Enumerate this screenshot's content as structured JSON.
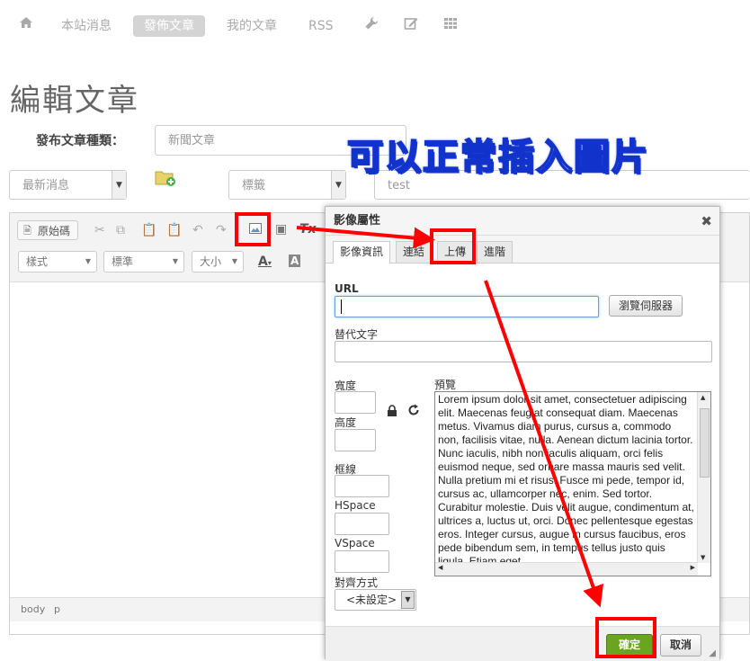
{
  "nav": {
    "items": [
      {
        "label": "本站消息",
        "active": false
      },
      {
        "label": "發佈文章",
        "active": true
      },
      {
        "label": "我的文章",
        "active": false
      },
      {
        "label": "RSS",
        "active": false
      }
    ]
  },
  "page": {
    "title": "編輯文章",
    "category_label": "發布文章種類：",
    "category_value": "新聞文章",
    "subcategory_value": "最新消息",
    "tag_select_value": "標籤",
    "tag_input_value": "test"
  },
  "annotation": {
    "banner": "可以正常插入圖片",
    "color": "#ff0000"
  },
  "editor": {
    "source_label": "原始碼",
    "style_combo": "樣式",
    "format_combo": "標準",
    "size_combo": "大小",
    "status_path": [
      "body",
      "p"
    ]
  },
  "dialog": {
    "title": "影像屬性",
    "tabs": [
      {
        "label": "影像資訊",
        "selected": true
      },
      {
        "label": "連結",
        "selected": false
      },
      {
        "label": "上傳",
        "selected": false
      },
      {
        "label": "進階",
        "selected": false
      }
    ],
    "url_label": "URL",
    "browse_server_label": "瀏覽伺服器",
    "alt_label": "替代文字",
    "width_label": "寬度",
    "height_label": "高度",
    "border_label": "框線",
    "hspace_label": "HSpace",
    "vspace_label": "VSpace",
    "align_label": "對齊方式",
    "align_value": "<未設定>",
    "preview_label": "預覽",
    "preview_text": "Lorem ipsum dolor sit amet, consectetuer adipiscing elit. Maecenas feugiat consequat diam. Maecenas metus. Vivamus diam purus, cursus a, commodo non, facilisis vitae, nulla. Aenean dictum lacinia tortor. Nunc iaculis, nibh non iaculis aliquam, orci felis euismod neque, sed ornare massa mauris sed velit. Nulla pretium mi et risus. Fusce mi pede, tempor id, cursus ac, ullamcorper nec, enim. Sed tortor. Curabitur molestie. Duis velit augue, condimentum at, ultrices a, luctus ut, orci. Donec pellentesque egestas eros. Integer cursus, augue in cursus faucibus, eros pede bibendum sem, in tempus tellus justo quis ligula. Etiam eget",
    "ok_label": "確定",
    "cancel_label": "取消",
    "ok_color": "#6aa520"
  }
}
